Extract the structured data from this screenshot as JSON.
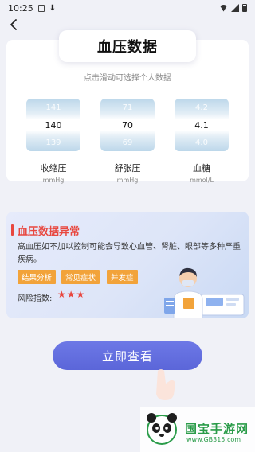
{
  "status": {
    "time": "10:25"
  },
  "header": {
    "title": "血压数据",
    "hint": "点击滑动可选择个人数据"
  },
  "pickers": [
    {
      "prev": "141",
      "current": "140",
      "next": "139",
      "label": "收缩压",
      "unit": "mmHg"
    },
    {
      "prev": "71",
      "current": "70",
      "next": "69",
      "label": "舒张压",
      "unit": "mmHg"
    },
    {
      "prev": "4.2",
      "current": "4.1",
      "next": "4.0",
      "label": "血糖",
      "unit": "mmol/L"
    }
  ],
  "alert": {
    "title": "血压数据异常",
    "description": "高血压如不加以控制可能会导致心血管、肾脏、眼部等多种严重疾病。",
    "tags": [
      "结果分析",
      "常见症状",
      "并发症"
    ],
    "risk_label": "风险指数:",
    "risk_level": 3,
    "risk_stars": "★★★"
  },
  "cta": {
    "label": "立即查看"
  },
  "watermark": {
    "brand": "国宝手游网",
    "url": "www.GB315.com"
  },
  "colors": {
    "accent": "#5b66d9",
    "alert_red": "#e8473f",
    "tag_orange": "#f2a33a"
  },
  "icons": {
    "back": "chevron-left-icon",
    "hand": "pointing-hand-icon",
    "doctor": "doctor-illustration"
  }
}
